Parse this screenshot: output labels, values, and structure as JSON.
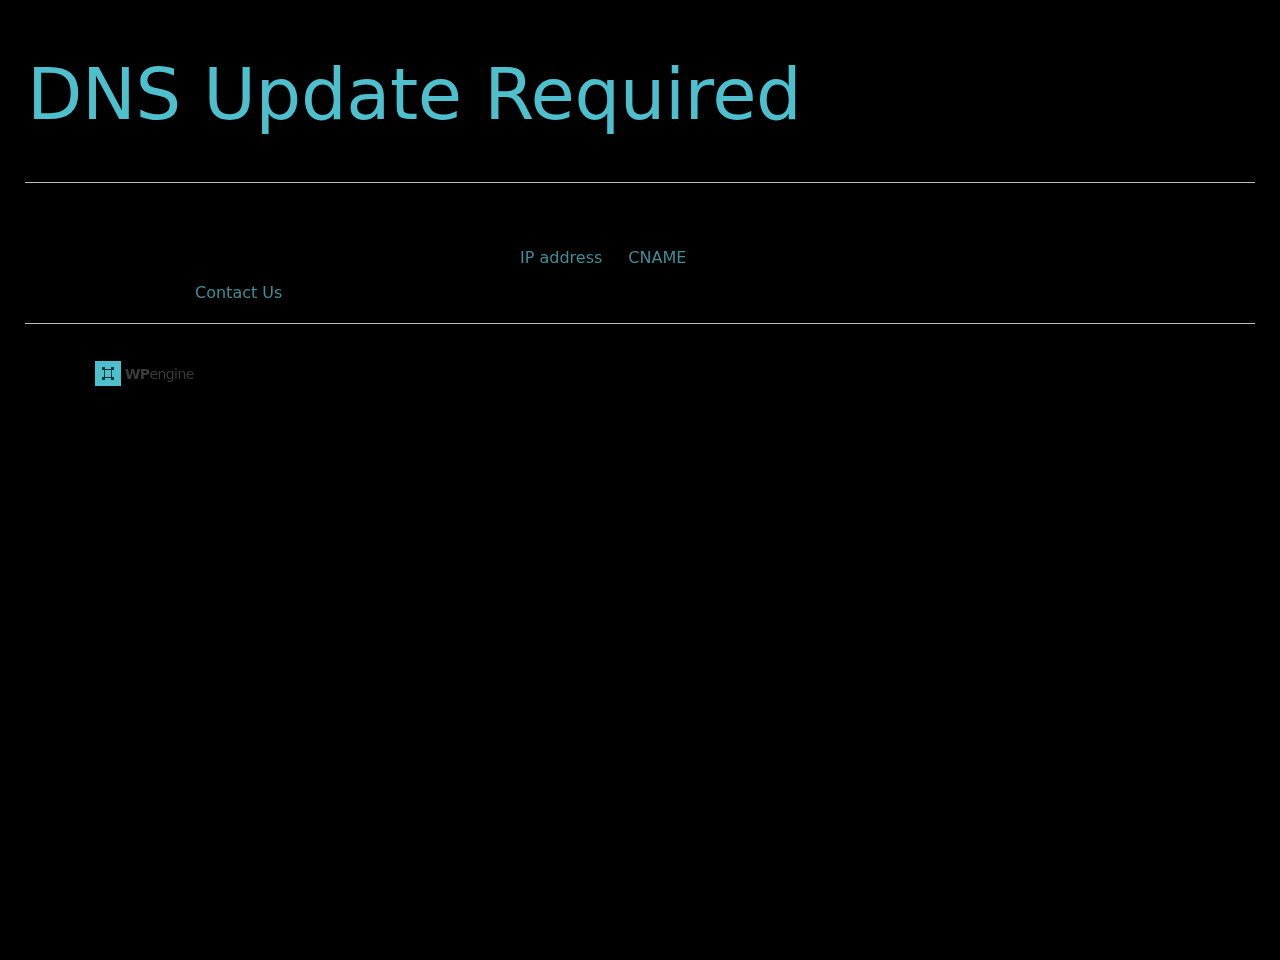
{
  "page": {
    "title": "DNS Update Required"
  },
  "instructions": {
    "links": [
      {
        "label": "IP address"
      },
      {
        "label": "CNAME"
      }
    ],
    "contact_link": {
      "label": "Contact Us"
    }
  },
  "footer": {
    "logo_text": "**WP**engine"
  }
}
